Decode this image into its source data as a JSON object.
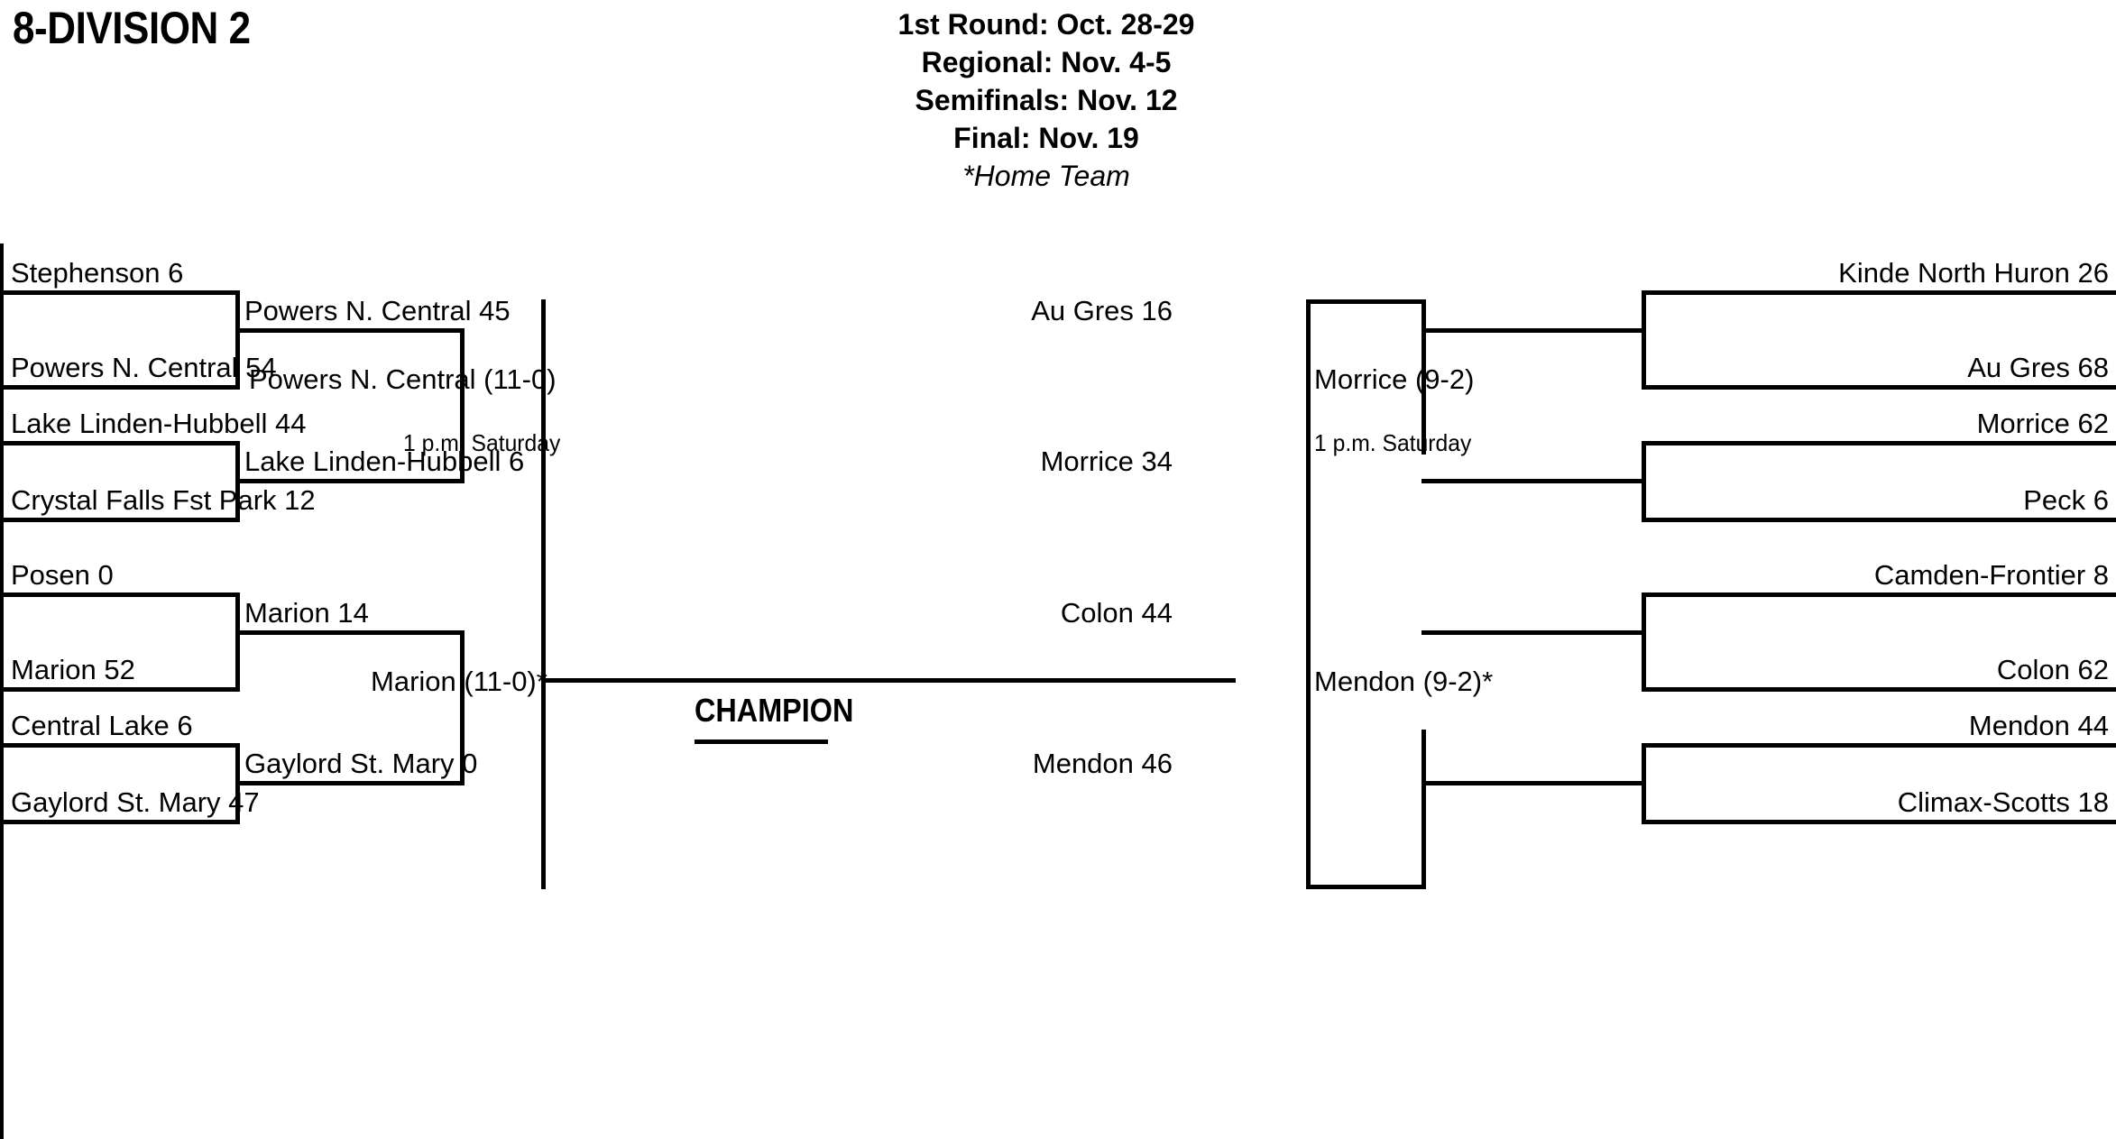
{
  "page": {
    "title": "8-DIVISION 2",
    "background_color": "#ffffff",
    "line_color": "#000000"
  },
  "header": {
    "schedule": [
      "1st Round: Oct. 28-29",
      "Regional: Nov. 4-5",
      "Semifinals: Nov. 12",
      "Final: Nov. 19"
    ],
    "note": "*Home Team"
  },
  "center": {
    "champion_label": "CHAMPION",
    "time_left": "1 p.m. Saturday",
    "time_right": "1 p.m.  Saturday"
  },
  "bracket": {
    "left": {
      "first_round": [
        {
          "top": "Stephenson 6",
          "bottom": "Powers N. Central 54"
        },
        {
          "top": "Lake Linden-Hubbell 44",
          "bottom": "Crystal Falls Fst Park 12"
        },
        {
          "top": "Posen 0",
          "bottom": "Marion 52"
        },
        {
          "top": "Central Lake 6",
          "bottom": "Gaylord St. Mary 47"
        }
      ],
      "regional": [
        "Powers N. Central 45",
        "Lake Linden-Hubbell 6",
        "Marion 14",
        "Gaylord St. Mary 0"
      ],
      "semifinal": [
        "Powers N. Central (11-0)",
        "Marion (11-0)*"
      ]
    },
    "right": {
      "first_round": [
        {
          "top": "Kinde North Huron 26",
          "bottom": "Au Gres 68"
        },
        {
          "top": "Morrice 62",
          "bottom": "Peck 6"
        },
        {
          "top": "Camden-Frontier 8",
          "bottom": "Colon 62"
        },
        {
          "top": "Mendon 44",
          "bottom": "Climax-Scotts 18"
        }
      ],
      "regional": [
        "Au Gres 16",
        "Morrice 34",
        "Colon 44",
        "Mendon 46"
      ],
      "semifinal": [
        "Morrice (9-2)",
        "Mendon (9-2)*"
      ]
    }
  }
}
